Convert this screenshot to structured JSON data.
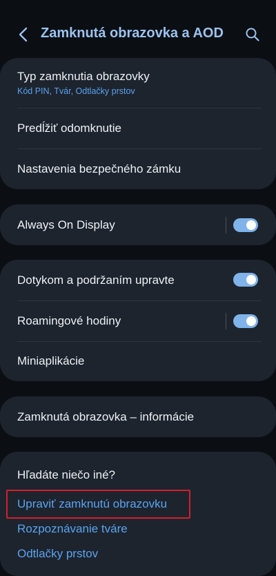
{
  "header": {
    "title": "Zamknutá obrazovka a AOD",
    "back_icon": "chevron-left-icon",
    "search_icon": "search-icon"
  },
  "lock_card": {
    "lock_type_title": "Typ zamknutia obrazovky",
    "lock_type_sub": "Kód PIN, Tvár, Odtlačky prstov",
    "extend_unlock": "Predĺžiť odomknutie",
    "secure_lock_settings": "Nastavenia bezpečného zámku"
  },
  "aod_card": {
    "aod_label": "Always On Display",
    "aod_enabled": true
  },
  "edit_card": {
    "touch_hold_label": "Dotykom a podržaním upravte",
    "touch_hold_enabled": true,
    "roaming_clock_label": "Roamingové hodiny",
    "roaming_clock_enabled": true,
    "widgets_label": "Miniaplikácie"
  },
  "info_card": {
    "about_label": "Zamknutá obrazovka – informácie"
  },
  "suggestions": {
    "heading": "Hľadáte niečo iné?",
    "links": [
      "Upraviť zamknutú obrazovku",
      "Rozpoznávanie tváre",
      "Odtlačky prstov"
    ]
  },
  "colors": {
    "background": "#0b0e13",
    "card": "#1d242e",
    "accent": "#9bc3ef",
    "link": "#5ba3ee",
    "toggle_on": "#7fb3ea",
    "highlight": "#d2202a"
  }
}
